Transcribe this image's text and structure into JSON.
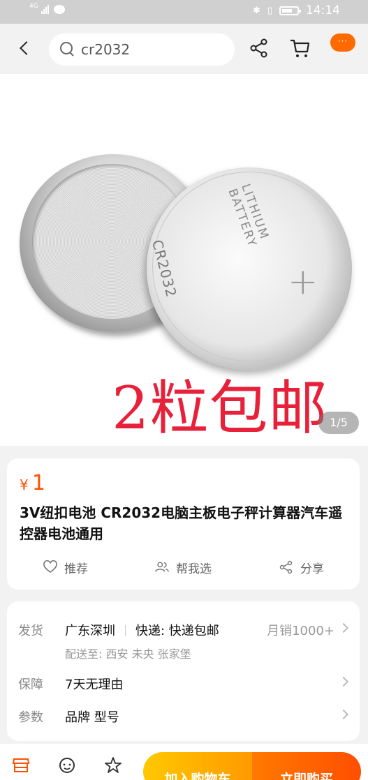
{
  "status_bar": {
    "network": "4G",
    "time": "14:14"
  },
  "search": {
    "value": "cr2032"
  },
  "nav": {
    "more_label": "···"
  },
  "gallery": {
    "promo_text": "2粒包邮",
    "coin_model": "CR2032",
    "coin_label": "LITHIUM BATTERY",
    "page_indicator": "1/5"
  },
  "product": {
    "currency": "¥",
    "price": "1",
    "title": "3V纽扣电池 CR2032电脑主板电子秤计算器汽车遥控器电池通用",
    "actions": [
      {
        "label": "推荐",
        "icon": "heart-icon"
      },
      {
        "label": "帮我选",
        "icon": "people-icon"
      },
      {
        "label": "分享",
        "icon": "share-icon"
      }
    ]
  },
  "details": {
    "shipping": {
      "label": "发货",
      "origin": "广东深圳",
      "express": "快递: 快递包邮",
      "monthly_sales": "月销1000+",
      "deliver_to": "配送至: 西安 未央 张家堡"
    },
    "guarantee": {
      "label": "保障",
      "value": "7天无理由"
    },
    "params": {
      "label": "参数",
      "value": "品牌 型号"
    }
  },
  "bottom_bar": {
    "add_to_cart": "加入购物车",
    "buy_now": "立即购买",
    "icons": [
      "store-icon",
      "customer-service-icon",
      "star-icon"
    ]
  },
  "colors": {
    "accent": "#ff5000",
    "cart_button": "#ffb400",
    "buy_button": "#ff5a00"
  }
}
